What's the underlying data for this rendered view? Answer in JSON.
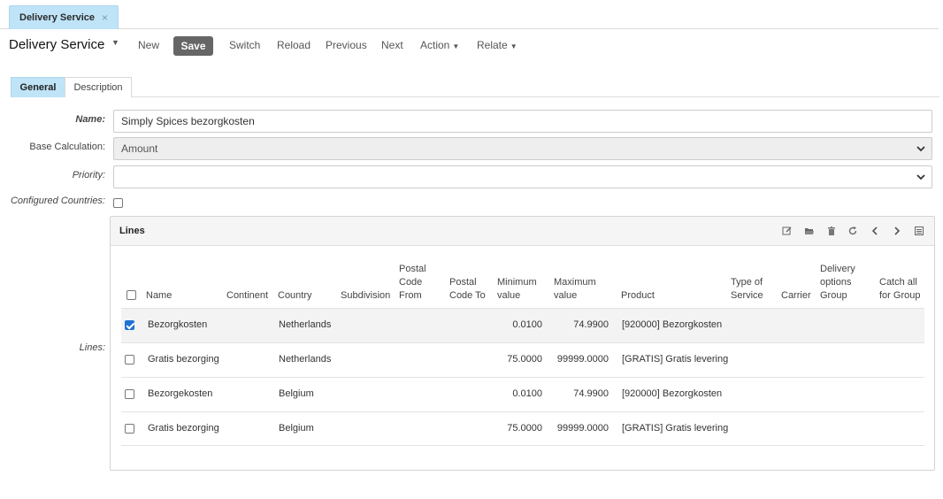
{
  "tab": {
    "label": "Delivery Service",
    "close": "×"
  },
  "toolbar": {
    "title": "Delivery Service",
    "new": "New",
    "save": "Save",
    "switch": "Switch",
    "reload": "Reload",
    "previous": "Previous",
    "next": "Next",
    "action": "Action",
    "relate": "Relate"
  },
  "form_tabs": [
    "General",
    "Description"
  ],
  "fields": {
    "name_label": "Name:",
    "name_value": "Simply Spices bezorgkosten",
    "base_calc_label": "Base Calculation:",
    "base_calc_value": "Amount",
    "priority_label": "Priority:",
    "priority_value": "",
    "countries_label": "Configured Countries:",
    "lines_label": "Lines:"
  },
  "lines": {
    "title": "Lines",
    "columns": {
      "name": "Name",
      "continent": "Continent",
      "country": "Country",
      "subdivision": "Subdivision",
      "postal_from": [
        "Postal",
        "Code",
        "From"
      ],
      "postal_to": [
        "Postal",
        "Code To"
      ],
      "min": [
        "Minimum",
        "value"
      ],
      "max": [
        "Maximum",
        "value"
      ],
      "product": "Product",
      "type": [
        "Type of",
        "Service"
      ],
      "carrier": "Carrier",
      "delivery_group": [
        "Delivery",
        "options",
        "Group"
      ],
      "catch_all": [
        "Catch all",
        "for Group"
      ]
    },
    "rows": [
      {
        "selected": true,
        "name": "Bezorgkosten",
        "country": "Netherlands",
        "min": "0.0100",
        "max": "74.9900",
        "product": "[920000] Bezorgkosten"
      },
      {
        "selected": false,
        "name": "Gratis bezorging",
        "country": "Netherlands",
        "min": "75.0000",
        "max": "99999.0000",
        "product": "[GRATIS] Gratis levering"
      },
      {
        "selected": false,
        "name": "Bezorgekosten",
        "country": "Belgium",
        "min": "0.0100",
        "max": "74.9900",
        "product": "[920000] Bezorgkosten"
      },
      {
        "selected": false,
        "name": "Gratis bezorging",
        "country": "Belgium",
        "min": "75.0000",
        "max": "99999.0000",
        "product": "[GRATIS] Gratis levering"
      }
    ]
  }
}
